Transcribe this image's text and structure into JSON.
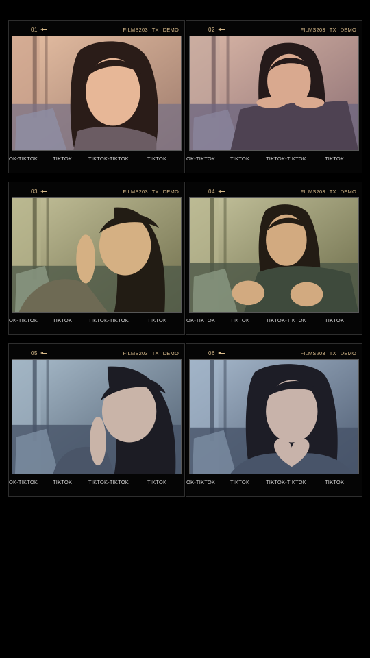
{
  "frames": [
    {
      "number": "01",
      "film": "FILMS203",
      "mode": "TX",
      "tag": "DEMO",
      "tone": "#c49a82",
      "strip": [
        "OK-TIKTOK",
        "TIKTOK",
        "TIKTOK-TIKTOK",
        "TIKTOK"
      ],
      "pose": "smile-tilt"
    },
    {
      "number": "02",
      "film": "FILMS203",
      "mode": "TX",
      "tag": "DEMO",
      "tone": "#b48d88",
      "strip": [
        "OK-TIKTOK",
        "TIKTOK",
        "TIKTOK-TIKTOK",
        "TIKTOK"
      ],
      "pose": "hands-under-chin"
    },
    {
      "number": "03",
      "film": "FILMS203",
      "mode": "TX",
      "tag": "DEMO",
      "tone": "#9f9b66",
      "strip": [
        "OK-TIKTOK",
        "TIKTOK",
        "TIKTOK-TIKTOK",
        "TIKTOK"
      ],
      "pose": "kiss-hands"
    },
    {
      "number": "04",
      "film": "FILMS203",
      "mode": "TX",
      "tag": "DEMO",
      "tone": "#94955d",
      "strip": [
        "OK-TIKTOK",
        "TIKTOK",
        "TIKTOK-TIKTOK",
        "TIKTOK"
      ],
      "pose": "point-forward"
    },
    {
      "number": "05",
      "film": "FILMS203",
      "mode": "TX",
      "tag": "DEMO",
      "tone": "#6f8294",
      "strip": [
        "OK-TIKTOK",
        "TIKTOK",
        "TIKTOK-TIKTOK",
        "TIKTOK"
      ],
      "pose": "wink-lean"
    },
    {
      "number": "06",
      "film": "FILMS203",
      "mode": "TX",
      "tag": "DEMO",
      "tone": "#6e8096",
      "strip": [
        "OK-TIKTOK",
        "TIKTOK",
        "TIKTOK-TIKTOK",
        "TIKTOK"
      ],
      "pose": "heart-hands"
    }
  ]
}
